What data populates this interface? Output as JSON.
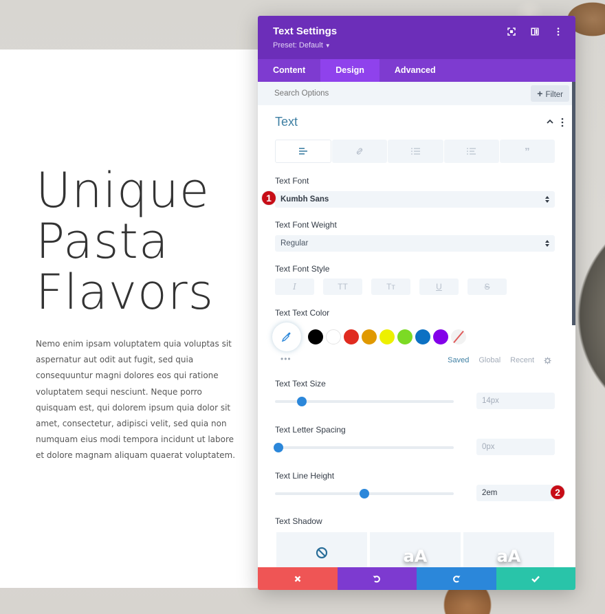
{
  "page": {
    "hero_title_lines": [
      "Unique",
      "Pasta",
      "Flavors"
    ],
    "hero_body": "Nemo enim ipsam voluptatem quia voluptas sit aspernatur aut odit aut fugit, sed quia consequuntur magni dolores eos qui ratione voluptatem sequi nesciunt. Neque porro quisquam est, qui dolorem ipsum quia dolor sit amet, consectetur, adipisci velit, sed quia non numquam eius modi tempora incidunt ut labore et dolore magnam aliquam quaerat voluptatem."
  },
  "modal": {
    "title": "Text Settings",
    "preset": "Preset: Default",
    "header_icons": [
      "focus-mode-icon",
      "split-view-icon",
      "more-options-icon"
    ],
    "tabs": [
      {
        "label": "Content",
        "active": false
      },
      {
        "label": "Design",
        "active": true
      },
      {
        "label": "Advanced",
        "active": false
      }
    ],
    "search": {
      "placeholder": "Search Options",
      "filter_label": "Filter"
    },
    "section": {
      "title": "Text",
      "subtabs": [
        "align-left-icon",
        "link-icon",
        "unordered-list-icon",
        "ordered-list-icon",
        "quote-icon"
      ]
    },
    "fields": {
      "text_font": {
        "label": "Text Font",
        "value": "Kumbh Sans"
      },
      "text_font_weight": {
        "label": "Text Font Weight",
        "value": "Regular"
      },
      "text_font_style": {
        "label": "Text Font Style",
        "options": [
          "I",
          "TT",
          "Tт",
          "U",
          "S"
        ]
      },
      "text_color": {
        "label": "Text Text Color",
        "swatches": [
          "#000000",
          "#ffffff",
          "#e02b20",
          "#e09900",
          "#edf000",
          "#7cda24",
          "#0c71c3",
          "#8300e9"
        ],
        "palette_tabs": [
          {
            "label": "Saved",
            "active": true
          },
          {
            "label": "Global",
            "active": false
          },
          {
            "label": "Recent",
            "active": false
          }
        ]
      },
      "text_size": {
        "label": "Text Text Size",
        "value": "14px",
        "slider_fraction": 0.15
      },
      "letter_spacing": {
        "label": "Text Letter Spacing",
        "value": "0px",
        "slider_fraction": 0.02
      },
      "line_height": {
        "label": "Text Line Height",
        "value": "2em",
        "slider_fraction": 0.5
      },
      "text_shadow": {
        "label": "Text Shadow",
        "options": [
          "none",
          "aA",
          "aA"
        ]
      }
    },
    "badges": [
      "1",
      "2"
    ],
    "footer": [
      "cancel",
      "undo",
      "redo",
      "save"
    ]
  },
  "colors": {
    "header": "#6c2eb9",
    "tabs": "#7e3bd0",
    "active_tab": "#8f42ec",
    "accent_blue": "#2b87da",
    "section_title": "#3e7fa3",
    "cancel": "#ef5555",
    "undo": "#7d3ad0",
    "redo": "#2b87da",
    "save": "#29c4a9",
    "badge": "#c70d17"
  }
}
